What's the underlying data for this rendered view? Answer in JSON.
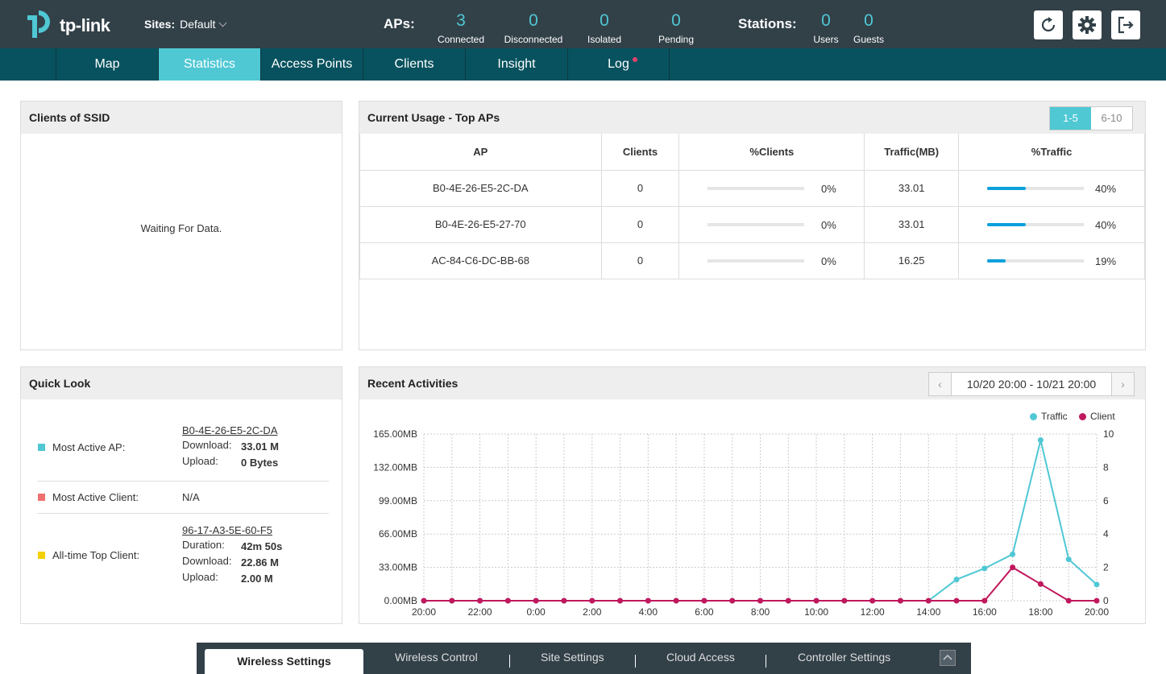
{
  "topbar": {
    "logo_text": "tp-link",
    "sites_label": "Sites:",
    "sites_value": "Default",
    "aps_label": "APs:",
    "stations_label": "Stations:",
    "aps": [
      {
        "value": "3",
        "label": "Connected"
      },
      {
        "value": "0",
        "label": "Disconnected"
      },
      {
        "value": "0",
        "label": "Isolated"
      },
      {
        "value": "0",
        "label": "Pending"
      }
    ],
    "stations": [
      {
        "value": "0",
        "label": "Users"
      },
      {
        "value": "0",
        "label": "Guests"
      }
    ],
    "icons": [
      "refresh-icon",
      "gear-icon",
      "logout-icon"
    ]
  },
  "nav": {
    "tabs": [
      {
        "label": "Map"
      },
      {
        "label": "Statistics"
      },
      {
        "label": "Access Points"
      },
      {
        "label": "Clients"
      },
      {
        "label": "Insight"
      },
      {
        "label": "Log"
      }
    ],
    "active": "Statistics"
  },
  "ssid_panel": {
    "title": "Clients of SSID",
    "empty_text": "Waiting For Data."
  },
  "top_aps": {
    "title": "Current Usage - Top APs",
    "pages": [
      "1-5",
      "6-10"
    ],
    "columns": [
      "AP",
      "Clients",
      "%Clients",
      "Traffic(MB)",
      "%Traffic"
    ],
    "rows": [
      {
        "ap": "B0-4E-26-E5-2C-DA",
        "clients": "0",
        "pct_clients": "0%",
        "pct_clients_val": 0,
        "traffic": "33.01",
        "pct_traffic": "40%",
        "pct_traffic_val": 40
      },
      {
        "ap": "B0-4E-26-E5-27-70",
        "clients": "0",
        "pct_clients": "0%",
        "pct_clients_val": 0,
        "traffic": "33.01",
        "pct_traffic": "40%",
        "pct_traffic_val": 40
      },
      {
        "ap": "AC-84-C6-DC-BB-68",
        "clients": "0",
        "pct_clients": "0%",
        "pct_clients_val": 0,
        "traffic": "16.25",
        "pct_traffic": "19%",
        "pct_traffic_val": 19
      }
    ]
  },
  "quick_look": {
    "title": "Quick Look",
    "most_active_ap": {
      "label": "Most Active AP:",
      "name": "B0-4E-26-E5-2C-DA",
      "download_label": "Download:",
      "download": "33.01 M",
      "upload_label": "Upload:",
      "upload": "0 Bytes",
      "color": "#4fc8d4"
    },
    "most_active_client": {
      "label": "Most Active Client:",
      "value": "N/A",
      "color": "#f07070"
    },
    "top_client": {
      "label": "All-time Top Client:",
      "name": "96-17-A3-5E-60-F5",
      "duration_label": "Duration:",
      "duration": "42m 50s",
      "download_label": "Download:",
      "download": "22.86 M",
      "upload_label": "Upload:",
      "upload": "2.00 M",
      "color": "#f5d000"
    }
  },
  "recent": {
    "title": "Recent Activities",
    "date_range": "10/20 20:00 - 10/21 20:00"
  },
  "chart_data": {
    "type": "line",
    "title": "",
    "x": [
      "20:00",
      "21:00",
      "22:00",
      "23:00",
      "0:00",
      "1:00",
      "2:00",
      "3:00",
      "4:00",
      "5:00",
      "6:00",
      "7:00",
      "8:00",
      "9:00",
      "10:00",
      "11:00",
      "12:00",
      "13:00",
      "14:00",
      "15:00",
      "16:00",
      "17:00",
      "18:00",
      "19:00",
      "20:00"
    ],
    "x_tick_labels": [
      "20:00",
      "22:00",
      "0:00",
      "2:00",
      "4:00",
      "6:00",
      "8:00",
      "10:00",
      "12:00",
      "14:00",
      "16:00",
      "18:00",
      "20:00"
    ],
    "y_left_ticks": [
      "165.00MB",
      "132.00MB",
      "99.00MB",
      "66.00MB",
      "33.00MB",
      "0.00MB"
    ],
    "y_right_ticks": [
      "10",
      "8",
      "6",
      "4",
      "2",
      "0"
    ],
    "y_left_range": [
      0,
      165
    ],
    "y_right_range": [
      0,
      10
    ],
    "grid": true,
    "legend_position": "top-right",
    "series": [
      {
        "name": "Traffic",
        "axis": "left",
        "unit": "MB",
        "color": "#4fc8d4",
        "values": [
          0,
          0,
          0,
          0,
          0,
          0,
          0,
          0,
          0,
          0,
          0,
          0,
          0,
          0,
          0,
          0,
          0,
          0,
          0,
          21,
          32,
          46,
          159,
          41,
          16
        ]
      },
      {
        "name": "Client",
        "axis": "right",
        "color": "#c0185c",
        "values": [
          0,
          0,
          0,
          0,
          0,
          0,
          0,
          0,
          0,
          0,
          0,
          0,
          0,
          0,
          0,
          0,
          0,
          0,
          0,
          0,
          0,
          2,
          1,
          0,
          0
        ]
      }
    ]
  },
  "bottom": {
    "tabs": [
      "Wireless Settings",
      "Wireless Control",
      "Site Settings",
      "Cloud Access",
      "Controller Settings"
    ],
    "active": "Wireless Settings"
  }
}
